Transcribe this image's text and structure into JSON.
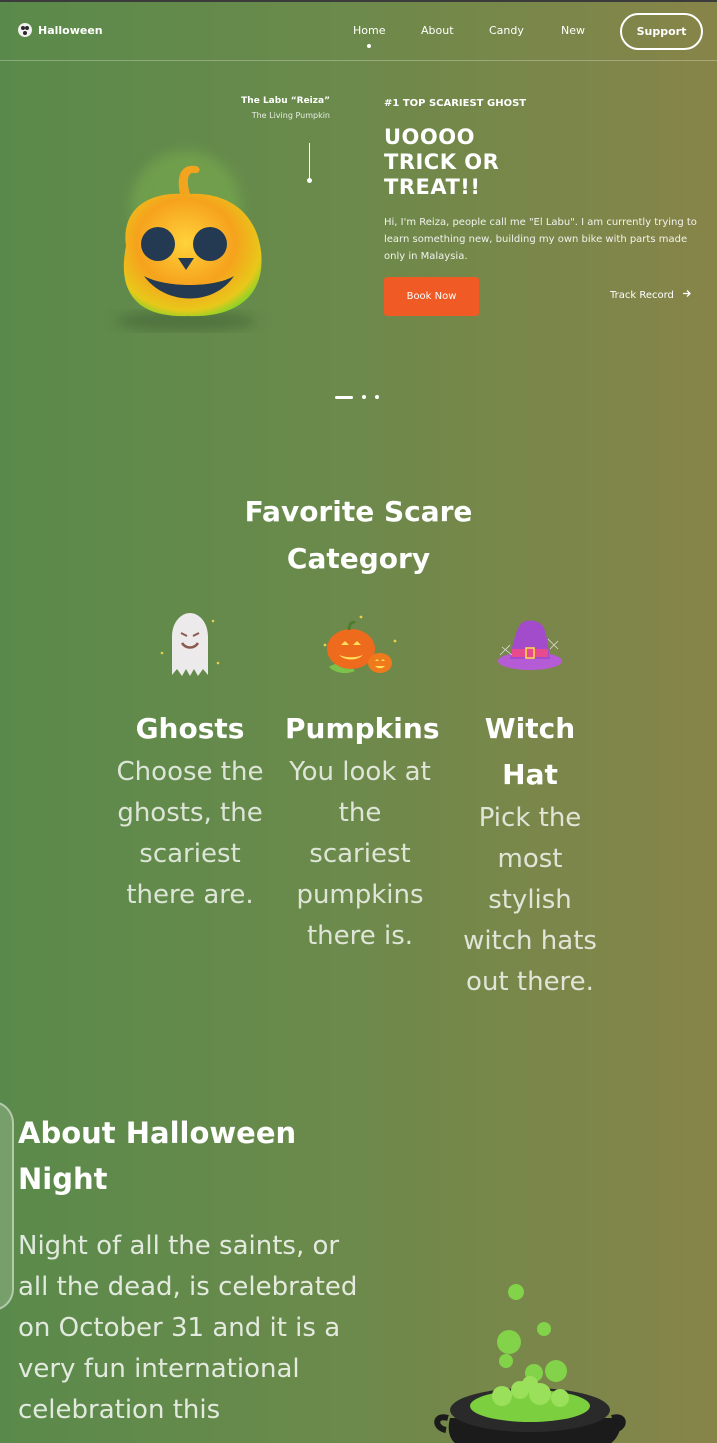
{
  "nav": {
    "brand": "Halloween",
    "links": [
      "Home",
      "About",
      "Candy",
      "New"
    ],
    "support_label": "Support"
  },
  "hero": {
    "character_name": "The Labu “Reiza”",
    "character_subtitle": "The Living Pumpkin",
    "kicker": "#1 TOP SCARIEST GHOST",
    "title": "UOOOO TRICK OR TREAT!!",
    "description": "Hi, I'm Reiza, people call me \"El Labu\". I am currently trying to learn something new, building my own bike with parts made only in Malaysia.",
    "book_label": "Book Now",
    "track_label": "Track Record",
    "slides_total": 3,
    "slide_active": 1
  },
  "category": {
    "title_line1": "Favorite Scare",
    "title_line2": "Category",
    "cards": [
      {
        "icon": "ghost-icon",
        "name": "Ghosts",
        "desc": "Choose the ghosts, the scariest there are."
      },
      {
        "icon": "pumpkins-icon",
        "name": "Pumpkins",
        "desc": "You look at the scariest pumpkins there is."
      },
      {
        "icon": "witch-hat-icon",
        "name": "Witch Hat",
        "desc": "Pick the most stylish witch hats out there."
      }
    ]
  },
  "about": {
    "title": "About Halloween Night",
    "body": "Night of all the saints, or all the dead, is celebrated on October 31 and it is a very fun international celebration this"
  },
  "colors": {
    "accent": "#f05a24",
    "bg_left": "#5a8a4b",
    "bg_right": "#878449"
  }
}
